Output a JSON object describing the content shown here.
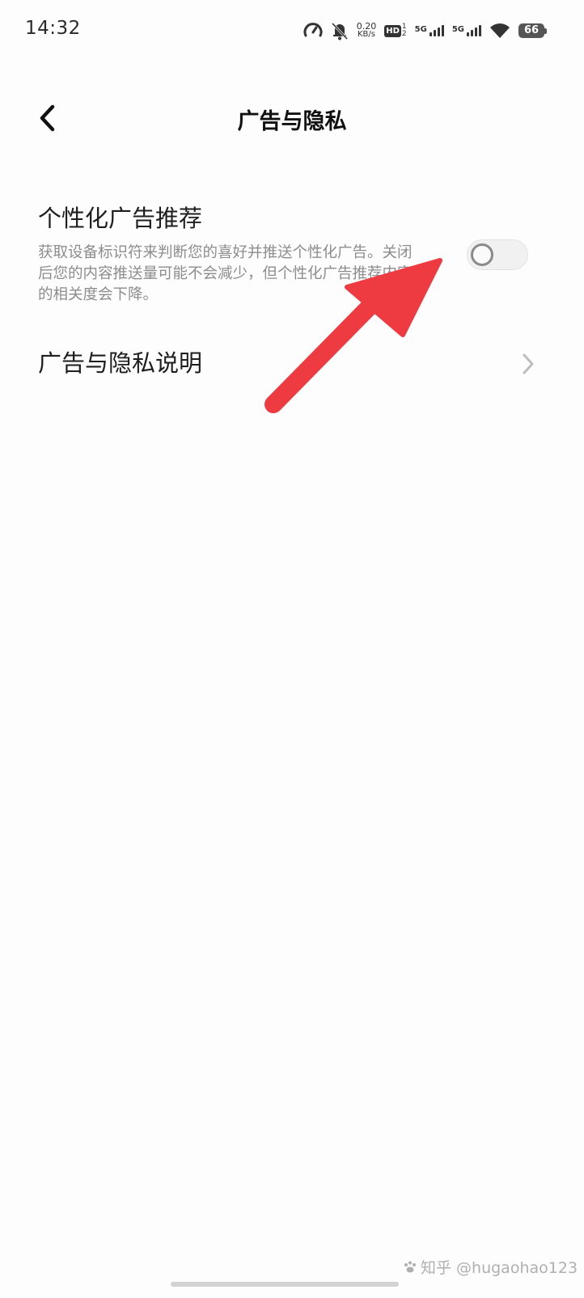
{
  "status_bar": {
    "time": "14:32",
    "net_speed_value": "0.20",
    "net_speed_unit": "KB/s",
    "hd_label": "HD",
    "hd_sim_1": "1",
    "hd_sim_2": "2",
    "signal_1_label": "5G",
    "signal_2_label": "5G",
    "battery_level": "66",
    "icons": [
      "speedometer-icon",
      "bell-off-icon",
      "signal-icon",
      "signal-icon",
      "wifi-icon",
      "battery-icon"
    ]
  },
  "header": {
    "title": "广告与隐私",
    "back_icon": "chevron-left-icon"
  },
  "settings": {
    "personalized_ads": {
      "title": "个性化广告推荐",
      "description": "获取设备标识符来判断您的喜好并推送个性化广告。关闭后您的内容推送量可能不会减少，但个性化广告推荐内容的相关度会下降。",
      "enabled": false
    },
    "privacy_explanation": {
      "title": "广告与隐私说明",
      "icon": "chevron-right-icon"
    }
  },
  "annotation": {
    "arrow_color": "#ee3b42",
    "icon": "red-arrow-icon"
  },
  "watermark": {
    "text": "知乎 @hugaohao123",
    "icon": "paw-icon"
  },
  "colors": {
    "background": "#fdfdfd",
    "title_text": "#111111",
    "desc_text": "#8d8d8d",
    "toggle_off": "#f1f1f1"
  }
}
